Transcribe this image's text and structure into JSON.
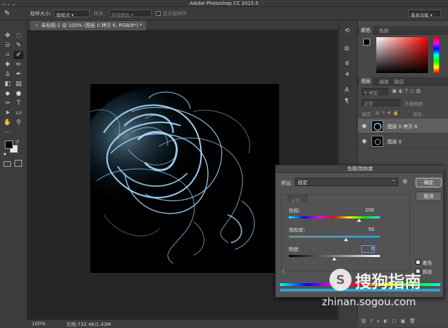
{
  "window": {
    "title": "Adobe Photoshop CC 2015.5"
  },
  "options_bar": {
    "sample_size_label": "取样大小:",
    "sample_size_value": "取样点",
    "sample_label": "样本:",
    "sample_value": "所有图层",
    "show_ring_label": "显示取样环",
    "workspace": "基本功能"
  },
  "document": {
    "tab_title": "未标题-1 @ 100% (图层 0 拷贝 6, RGB/8*) *"
  },
  "status": {
    "zoom": "100%",
    "doc_size": "文档:732.4K/1.43M"
  },
  "color_panel": {
    "tabs": [
      "颜色",
      "色板"
    ],
    "active": 0
  },
  "layers_panel": {
    "tabs": [
      "图层",
      "通道",
      "路径"
    ],
    "active": 0,
    "kind_label": "类型",
    "blend_mode": "正常",
    "opacity_label": "不透明度:",
    "lock_label": "锁定:",
    "fill_label": "填充:",
    "layers": [
      {
        "name": "图层 0 拷贝 6",
        "selected": true
      },
      {
        "name": "图层 0",
        "selected": false
      }
    ]
  },
  "dialog": {
    "title": "色相/饱和度",
    "preset_label": "预设:",
    "preset_value": "自定",
    "ok": "确定",
    "cancel": "取消",
    "channel": "全图",
    "hue_label": "色相:",
    "hue_value": "200",
    "hue_level": 0.77,
    "saturation_label": "饱和度:",
    "saturation_value": "50",
    "saturation_level": 0.625,
    "lightness_label": "明度:",
    "lightness_value": "0",
    "lightness_level": 0.5,
    "colorize_label": "着色",
    "preview_label": "预览",
    "colorize_checked": true,
    "preview_checked": true
  },
  "watermark": {
    "brand": "搜狗指南",
    "url": "zhinan.sogou.com"
  }
}
